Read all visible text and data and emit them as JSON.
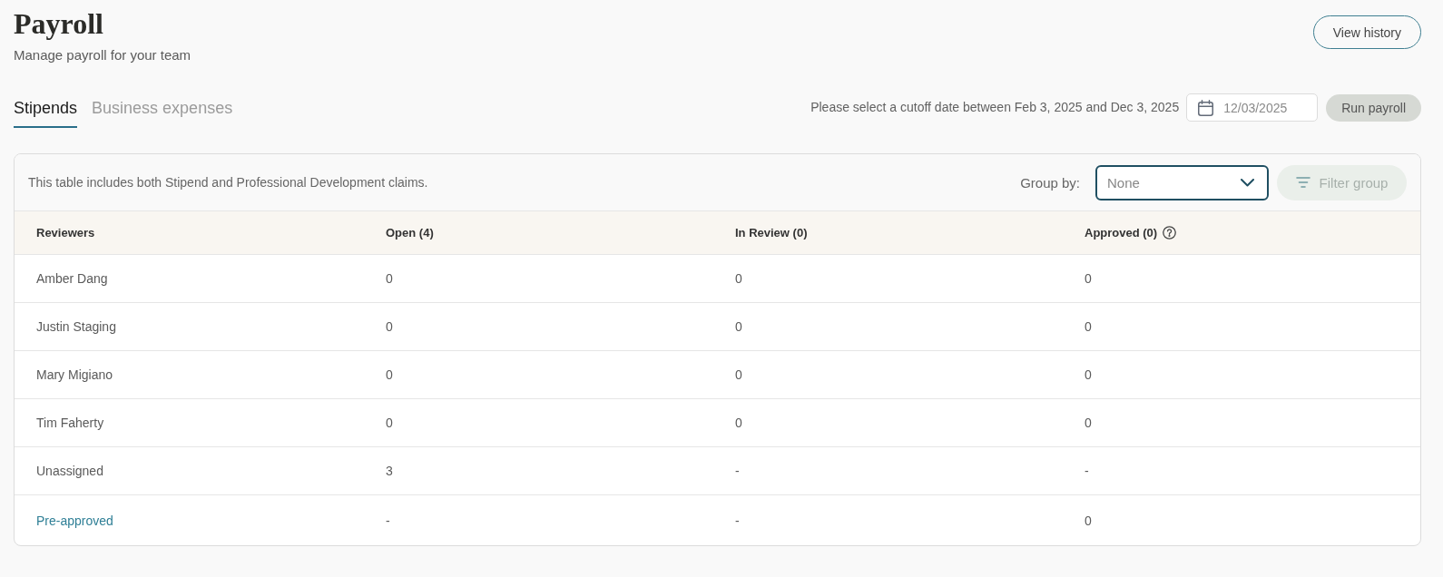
{
  "header": {
    "title": "Payroll",
    "subtitle": "Manage payroll for your team",
    "history_button": "View history"
  },
  "tabs": [
    {
      "label": "Stipends",
      "selected": true
    },
    {
      "label": "Business expenses",
      "selected": false
    }
  ],
  "cutoff": {
    "message": "Please select a cutoff date between Feb 3, 2025 and Dec 3, 2025",
    "date_field": {
      "value": "12/03/2025"
    },
    "run_button": {
      "label": "Run payroll",
      "disabled": true
    }
  },
  "table": {
    "note": "This table includes both Stipend and Professional Development claims.",
    "group_by": {
      "label": "Group by:",
      "value": "None"
    },
    "filter_button": {
      "label": "Filter group",
      "disabled": true
    },
    "columns": [
      {
        "label": "Reviewers",
        "help": false
      },
      {
        "label": "Open (4)",
        "help": false
      },
      {
        "label": "In Review (0)",
        "help": false
      },
      {
        "label": "Approved (0)",
        "help": true
      }
    ],
    "rows": [
      {
        "kind": "reviewer",
        "cells": [
          "Amber Dang",
          "0",
          "0",
          "0"
        ]
      },
      {
        "kind": "reviewer",
        "cells": [
          "Justin Staging",
          "0",
          "0",
          "0"
        ]
      },
      {
        "kind": "reviewer",
        "cells": [
          "Mary Migiano",
          "0",
          "0",
          "0"
        ]
      },
      {
        "kind": "reviewer",
        "cells": [
          "Tim Faherty",
          "0",
          "0",
          "0"
        ]
      },
      {
        "kind": "reviewer",
        "cells": [
          "Unassigned",
          "3",
          "-",
          "-"
        ]
      },
      {
        "kind": "link",
        "cells": [
          "Pre-approved",
          "-",
          "-",
          "0"
        ]
      }
    ]
  }
}
